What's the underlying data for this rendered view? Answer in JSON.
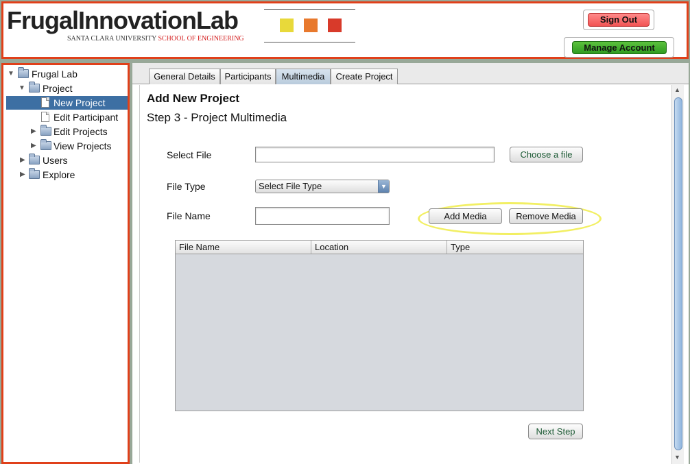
{
  "header": {
    "logo": "FrugalInnovationLab",
    "logo_sub_1": "SANTA CLARA UNIVERSITY",
    "logo_sub_2": "SCHOOL OF ENGINEERING",
    "squares": [
      "#e8d93a",
      "#e8792d",
      "#d83a2a"
    ],
    "sign_out_label": "Sign Out",
    "manage_account_label": "Manage Account"
  },
  "sidebar": {
    "items": [
      {
        "label": "Frugal Lab",
        "icon": "folder-icon",
        "expanded": true
      },
      {
        "label": "Project",
        "icon": "folder-icon",
        "expanded": true
      },
      {
        "label": "New Project",
        "icon": "document-icon",
        "selected": true
      },
      {
        "label": "Edit Participant",
        "icon": "document-icon"
      },
      {
        "label": "Edit Projects",
        "icon": "folder-icon",
        "expanded": false
      },
      {
        "label": "View Projects",
        "icon": "folder-icon",
        "expanded": false
      },
      {
        "label": "Users",
        "icon": "folder-icon",
        "expanded": false
      },
      {
        "label": "Explore",
        "icon": "folder-icon",
        "expanded": false
      }
    ]
  },
  "tabs": [
    {
      "label": "General Details"
    },
    {
      "label": "Participants"
    },
    {
      "label": "Multimedia",
      "active": true
    },
    {
      "label": "Create Project"
    }
  ],
  "form": {
    "title": "Add New Project",
    "step": "Step 3 - Project Multimedia",
    "select_file_label": "Select File",
    "select_file_value": "",
    "choose_file_label": "Choose a file",
    "file_type_label": "File Type",
    "file_type_value": "Select File Type",
    "file_name_label": "File Name",
    "file_name_value": "",
    "add_media_label": "Add Media",
    "remove_media_label": "Remove Media",
    "table_columns": [
      "File Name",
      "Location",
      "Type"
    ],
    "next_step_label": "Next Step"
  },
  "colors": {
    "frame_accent": "#e0401a",
    "selected_row": "#3d6fa3",
    "highlight_ring": "#f2ef63"
  }
}
